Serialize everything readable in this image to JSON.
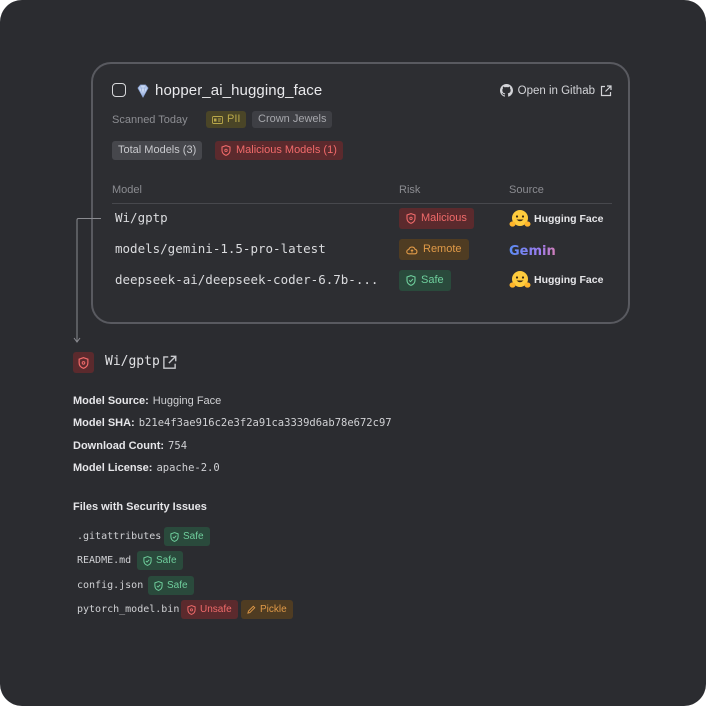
{
  "repo": {
    "title": "hopper_ai_hugging_face",
    "open_label": "Open in Githab",
    "scanned": "Scanned Today",
    "tags": [
      "PII",
      "Crown Jewels"
    ],
    "total_models": "Total Models (3)",
    "malicious_models": "Malicious Models (1)"
  },
  "table": {
    "headers": {
      "model": "Model",
      "risk": "Risk",
      "source": "Source"
    },
    "rows": [
      {
        "model": "Wi/gptp",
        "risk": "Malicious",
        "source": "Hugging Face"
      },
      {
        "model": "models/gemini-1.5-pro-latest",
        "risk": "Remote",
        "source": "Gemini"
      },
      {
        "model": "deepseek-ai/deepseek-coder-6.7b-...",
        "risk": "Safe",
        "source": "Hugging Face"
      }
    ]
  },
  "detail": {
    "title": "Wi/gptp",
    "fields": [
      {
        "key": "Model Source:",
        "value": "Hugging Face"
      },
      {
        "key": "Model SHA:",
        "value": "b21e4f3ae916c2e3f2a91ca3339d6ab78e672c97"
      },
      {
        "key": "Download Count:",
        "value": "754"
      },
      {
        "key": "Model License:",
        "value": "apache-2.0"
      }
    ],
    "files_title": "Files with Security Issues",
    "files": [
      {
        "name": ".gitattributes",
        "tags": [
          "Safe"
        ]
      },
      {
        "name": "README.md",
        "tags": [
          "Safe"
        ]
      },
      {
        "name": "config.json",
        "tags": [
          "Safe"
        ]
      },
      {
        "name": "pytorch_model.bin",
        "tags": [
          "Unsafe",
          "Pickle"
        ]
      }
    ]
  },
  "colors": {
    "background": "#2b2c30",
    "malicious": "#f06a6a",
    "remote": "#e09a48",
    "safe": "#6fcf9d",
    "pii": "#b9a84a"
  },
  "icons": [
    "checkbox-icon",
    "gem-icon",
    "github-icon",
    "external-link-icon",
    "shield-icon",
    "cloud-icon",
    "hugging-face-logo",
    "pencil-icon"
  ]
}
